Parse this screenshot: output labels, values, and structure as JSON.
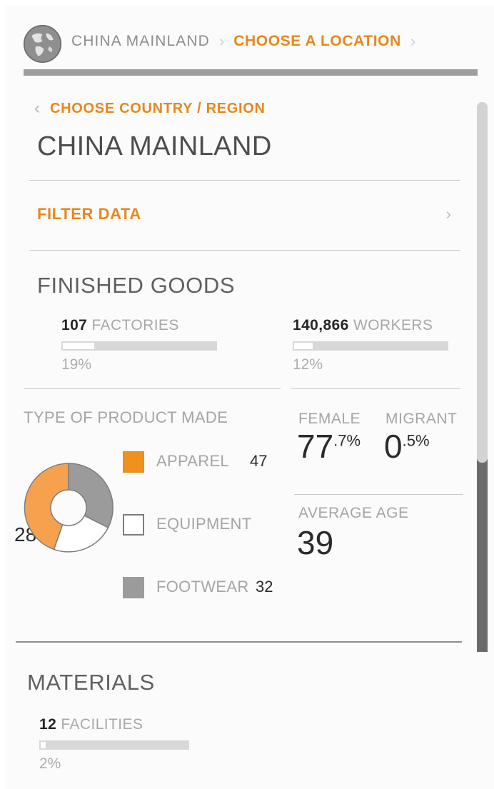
{
  "header": {
    "globe_icon": "globe-icon",
    "breadcrumbs": [
      {
        "label": "CHINA MAINLAND",
        "state": "muted"
      },
      {
        "label": "CHOOSE A LOCATION",
        "state": "active"
      }
    ],
    "separator": "›"
  },
  "nav": {
    "back_icon": "‹",
    "back_label": "CHOOSE COUNTRY / REGION",
    "country_title": "CHINA MAINLAND"
  },
  "filter": {
    "label": "FILTER DATA",
    "chevron": "›"
  },
  "finished_goods": {
    "title": "FINISHED GOODS",
    "factories": {
      "number": "107",
      "unit": "FACTORIES",
      "percent": "19%",
      "fill_ratio": 0.19
    },
    "workers": {
      "number": "140,866",
      "unit": "WORKERS",
      "percent": "12%",
      "fill_ratio": 0.12
    },
    "product_type": {
      "title": "TYPE OF PRODUCT MADE",
      "clipped_value": "28"
    },
    "demographics": {
      "female_label": "FEMALE",
      "female_whole": "77",
      "female_decimal": ".7%",
      "migrant_label": "MIGRANT",
      "migrant_whole": "0",
      "migrant_decimal": ".5%",
      "age_label": "AVERAGE AGE",
      "age_value": "39"
    }
  },
  "materials": {
    "title": "MATERIALS",
    "facilities": {
      "number": "12",
      "unit": "FACILITIES",
      "percent": "2%",
      "fill_ratio": 0.02
    }
  },
  "colors": {
    "accent_orange": "#e8871e",
    "apparel": "#f0901f",
    "equipment": "#ffffff",
    "footwear": "#9b9b9b",
    "text_dark": "#2b2b2b",
    "text_muted": "#a5a5a5"
  },
  "chart_data": {
    "type": "pie",
    "title": "TYPE OF PRODUCT MADE",
    "categories": [
      "APPAREL",
      "EQUIPMENT",
      "FOOTWEAR"
    ],
    "values": [
      47,
      28,
      32
    ],
    "percent_labels": [
      "43.9%",
      "26.2%",
      "29.9%"
    ],
    "colors": [
      "#f0901f",
      "#ffffff",
      "#9b9b9b"
    ],
    "total": 107,
    "donut": true,
    "legend_position": "right"
  }
}
